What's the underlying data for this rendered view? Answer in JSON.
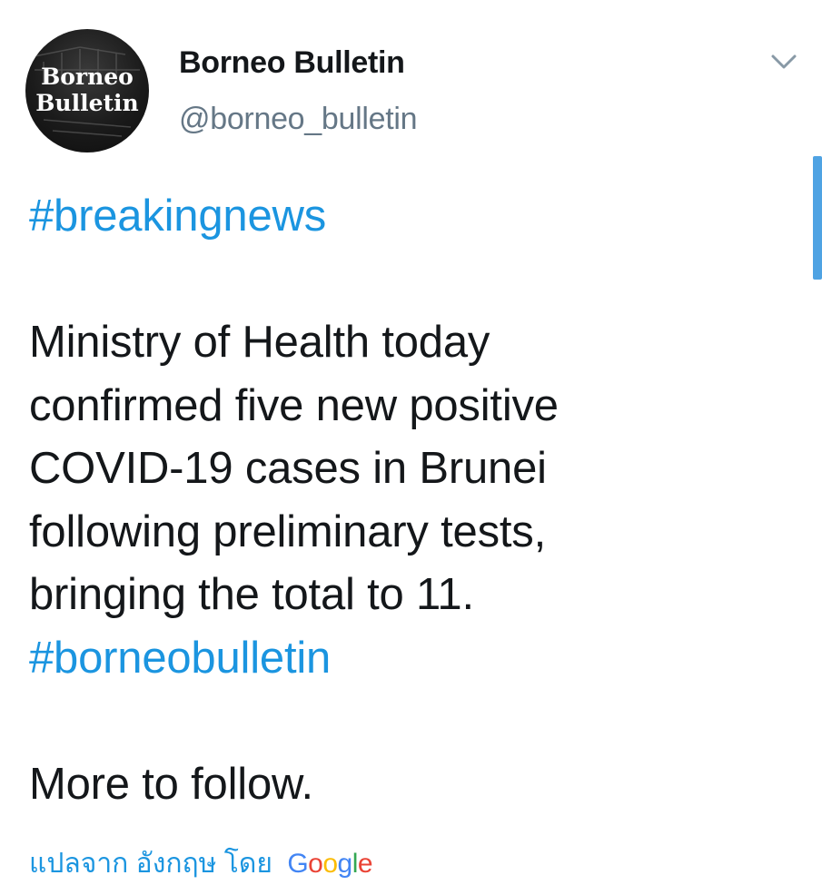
{
  "author": {
    "avatar_line1": "Borneo",
    "avatar_line2": "Bulletin",
    "display_name": "Borneo Bulletin",
    "handle": "@borneo_bulletin"
  },
  "menu": {
    "icon": "chevron-down-icon"
  },
  "tweet": {
    "hashtag_top": "#breakingnews",
    "lines": [
      "Ministry of Health today",
      "confirmed five new positive",
      "COVID-19 cases in Brunei",
      "following preliminary tests,",
      "bringing the total to 11."
    ],
    "hashtag_bottom": "#borneobulletin",
    "closing": "More to follow."
  },
  "translate": {
    "label": "แปลจาก อังกฤษ โดย",
    "provider_letters": [
      "G",
      "o",
      "o",
      "g",
      "l",
      "e"
    ]
  },
  "colors": {
    "link": "#1b95e0",
    "handle": "#657786",
    "text": "#14171a",
    "scroll_indicator": "#4fa3e3"
  }
}
